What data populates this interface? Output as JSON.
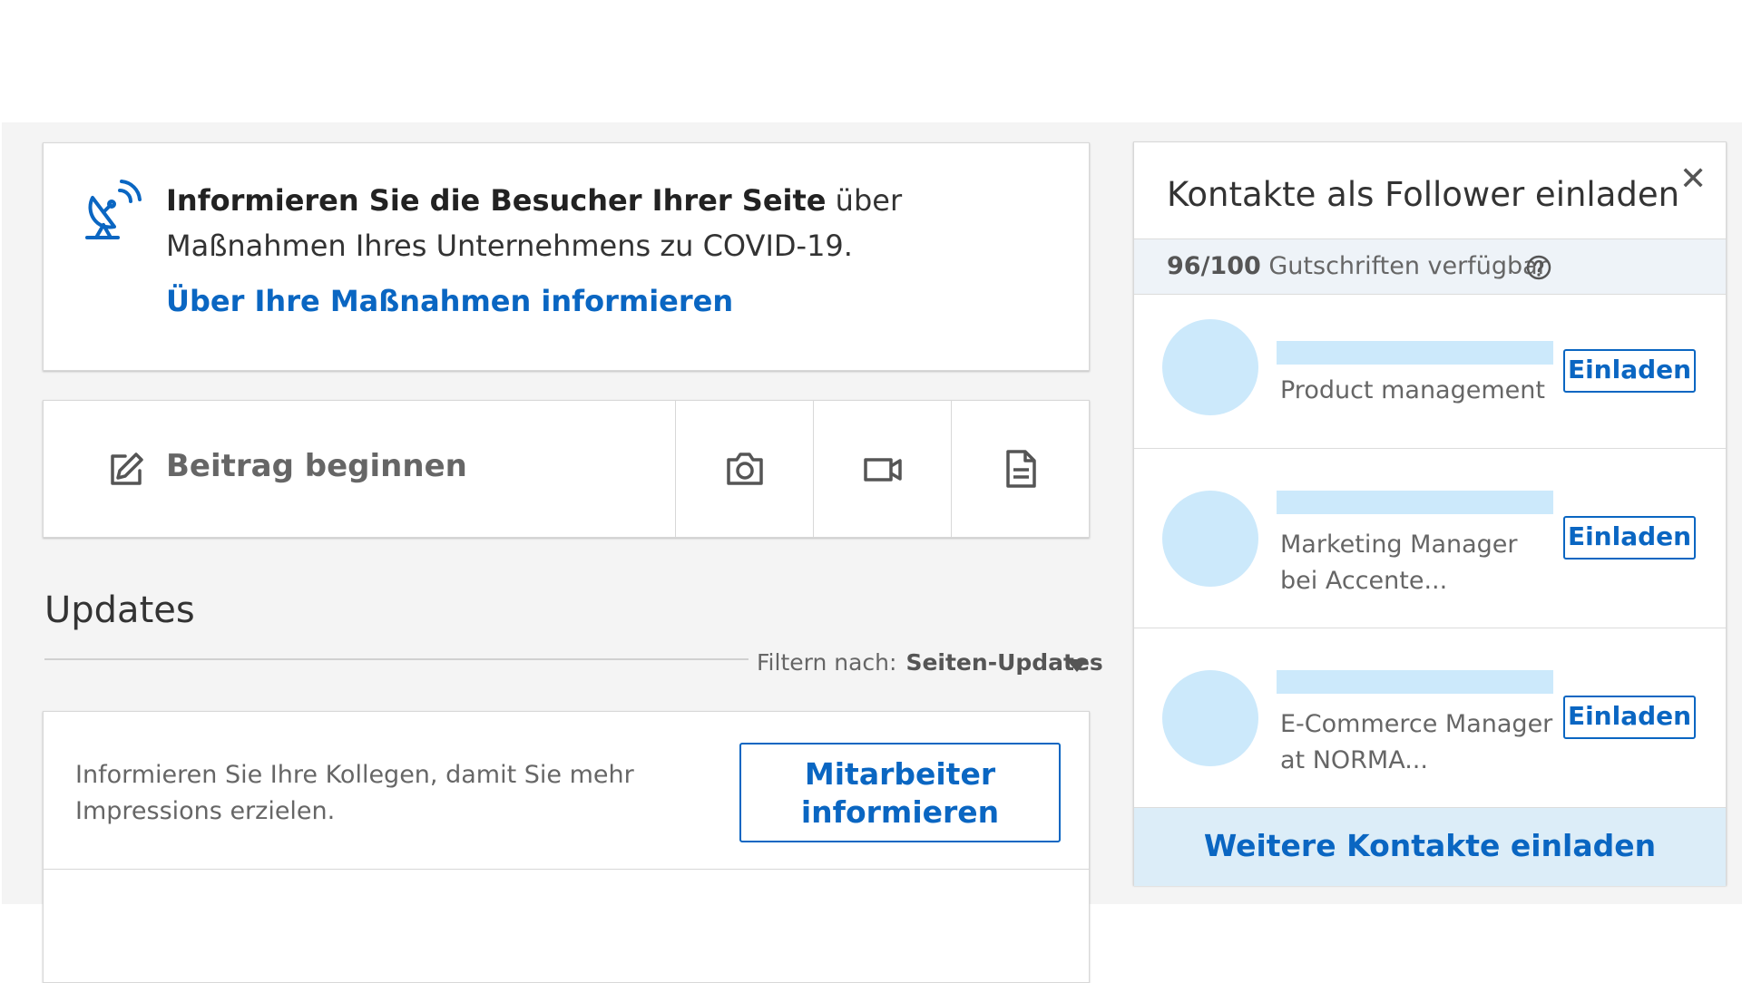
{
  "covid": {
    "bold_text": "Informieren Sie die Besucher Ihrer Seite",
    "text": " über Maßnahmen Ihres Unternehmens zu COVID-19.",
    "link": "Über Ihre Maßnahmen informieren",
    "icon": "satellite-dish-icon"
  },
  "composer": {
    "start_label": "Beitrag beginnen",
    "icons": [
      "edit-icon",
      "camera-icon",
      "video-icon",
      "document-icon"
    ]
  },
  "updates": {
    "title": "Updates",
    "filter_label": "Filtern nach:",
    "filter_value": "Seiten-Updates"
  },
  "colleagues": {
    "text": "Informieren Sie Ihre Kollegen, damit Sie mehr Impressions erzielen.",
    "button_line1": "Mitarbeiter",
    "button_line2": "informieren"
  },
  "invite_panel": {
    "title": "Kontakte als Follower einladen",
    "credits_number": "96/100",
    "credits_text": " Gutschriften verfügbar",
    "contacts": [
      {
        "headline": "Product management",
        "button": "Einladen"
      },
      {
        "headline": "Marketing Manager bei Accente...",
        "button": "Einladen"
      },
      {
        "headline": "E-Commerce Manager at NORMA...",
        "button": "Einladen"
      }
    ],
    "footer_link": "Weitere Kontakte einladen"
  },
  "colors": {
    "accent": "#0a66c2",
    "avatar_placeholder": "#cce9fb",
    "panel_footer_bg": "#dcedf8",
    "page_bg": "#f4f4f4"
  }
}
